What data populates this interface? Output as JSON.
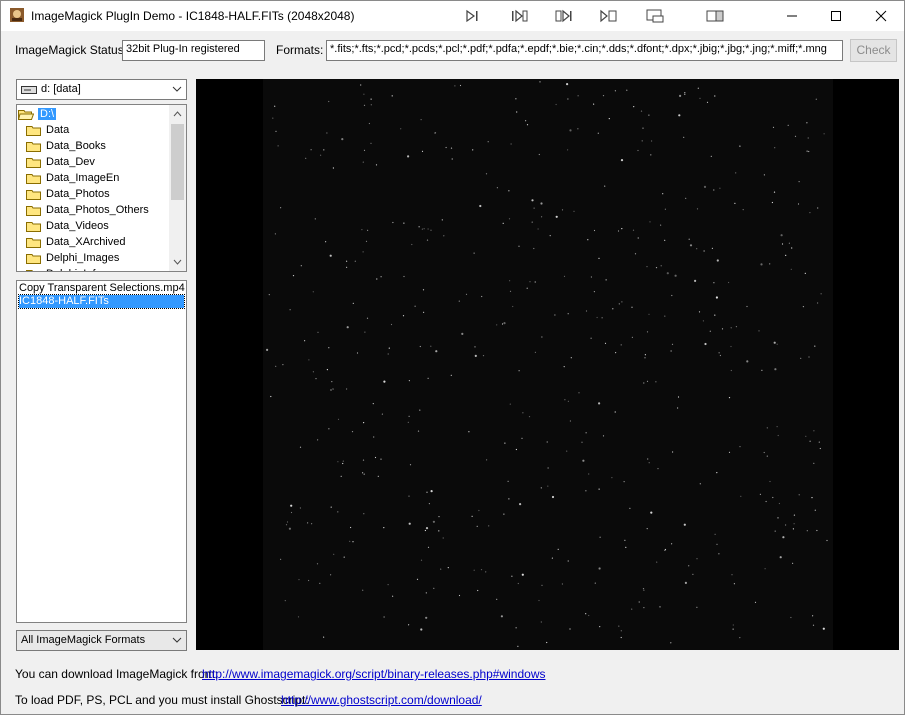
{
  "window": {
    "title": "ImageMagick PlugIn Demo - IC1848-HALF.FITs (2048x2048)",
    "toolbar_icons": [
      "first-icon",
      "previous-icon",
      "next-icon",
      "last-icon",
      "slideshow-icon",
      "fullscreen-icon"
    ],
    "controls": [
      "minimize-icon",
      "maximize-icon",
      "close-icon"
    ]
  },
  "status": {
    "label": "ImageMagick Status:",
    "value": "32bit Plug-In registered"
  },
  "formats": {
    "label": "Formats:",
    "value": "*.fits;*.fts;*.pcd;*.pcds;*.pcl;*.pdf;*.pdfa;*.epdf;*.bie;*.cin;*.dds;*.dfont;*.dpx;*.jbig;*.jbg;*.jng;*.miff;*.mng"
  },
  "check_button": "Check",
  "drive": {
    "selected": "d: [data]"
  },
  "folders": [
    {
      "label": "D:\\",
      "selected": true,
      "open": true
    },
    {
      "label": "Data"
    },
    {
      "label": "Data_Books"
    },
    {
      "label": "Data_Dev"
    },
    {
      "label": "Data_ImageEn"
    },
    {
      "label": "Data_Photos"
    },
    {
      "label": "Data_Photos_Others"
    },
    {
      "label": "Data_Videos"
    },
    {
      "label": "Data_XArchived"
    },
    {
      "label": "Delphi_Images"
    },
    {
      "label": "Delphi_Info"
    }
  ],
  "files": [
    {
      "label": "Copy Transparent Selections.mp4"
    },
    {
      "label": "IC1848-HALF.FITs",
      "selected": true
    }
  ],
  "filter": {
    "selected": "All ImageMagick Formats"
  },
  "footer": {
    "download_text": "You can download ImageMagick from:",
    "download_link": "http://www.imagemagick.org/script/binary-releases.php#windows",
    "ghostscript_text": "To load PDF, PS, PCL and you must install Ghostscript:",
    "ghostscript_link": "http://www.ghostscript.com/download/"
  },
  "colors": {
    "selection": "#3399ff",
    "link": "#0000cc",
    "viewer_bg": "#000000",
    "image_bg": "#0a0a0a"
  }
}
